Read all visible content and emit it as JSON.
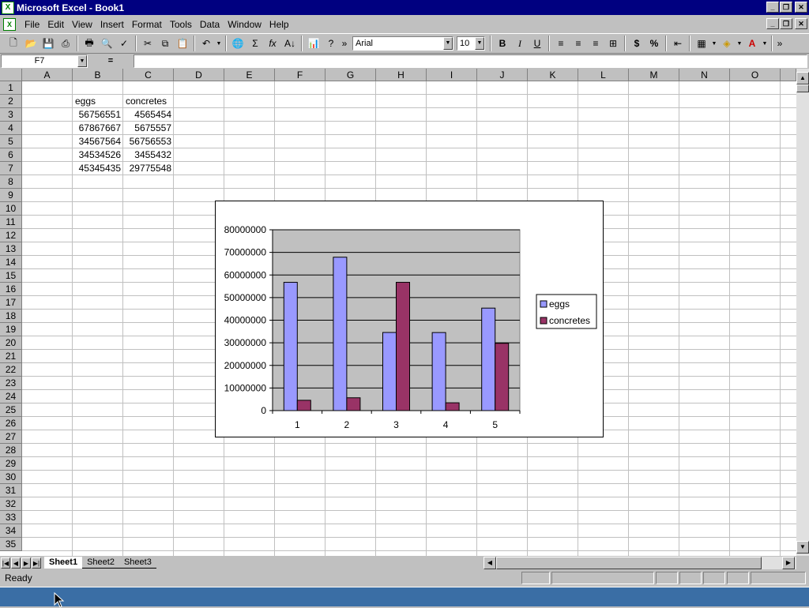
{
  "window": {
    "title": "Microsoft Excel - Book1"
  },
  "menu": [
    "File",
    "Edit",
    "View",
    "Insert",
    "Format",
    "Tools",
    "Data",
    "Window",
    "Help"
  ],
  "toolbar": {
    "font": "Arial",
    "size": "10"
  },
  "formula": {
    "namebox": "F7",
    "eq": "=",
    "value": ""
  },
  "columns": [
    "A",
    "B",
    "C",
    "D",
    "E",
    "F",
    "G",
    "H",
    "I",
    "J",
    "K",
    "L",
    "M",
    "N",
    "O"
  ],
  "rows": [
    "1",
    "2",
    "3",
    "4",
    "5",
    "6",
    "7",
    "8",
    "9",
    "10",
    "11",
    "12",
    "13",
    "14",
    "15",
    "16",
    "17",
    "18",
    "19",
    "20",
    "21",
    "22",
    "23",
    "24",
    "25",
    "26",
    "27",
    "28",
    "29",
    "30",
    "31",
    "32",
    "33",
    "34",
    "35"
  ],
  "cells": {
    "b2": "eggs",
    "c2": "concretes",
    "b3": "56756551",
    "c3": "4565454",
    "b4": "67867667",
    "c4": "5675557",
    "b5": "34567564",
    "c5": "56756553",
    "b6": "34534526",
    "c6": "3455432",
    "b7": "45345435",
    "c7": "29775548"
  },
  "chart_data": {
    "type": "bar",
    "categories": [
      "1",
      "2",
      "3",
      "4",
      "5"
    ],
    "series": [
      {
        "name": "eggs",
        "values": [
          56756551,
          67867667,
          34567564,
          34534526,
          45345435
        ],
        "color": "#9999ff"
      },
      {
        "name": "concretes",
        "values": [
          4565454,
          5675557,
          56756553,
          3455432,
          29775548
        ],
        "color": "#993366"
      }
    ],
    "ylim": [
      0,
      80000000
    ],
    "yticks": [
      "0",
      "10000000",
      "20000000",
      "30000000",
      "40000000",
      "50000000",
      "60000000",
      "70000000",
      "80000000"
    ],
    "plot_bg": "#c0c0c0",
    "grid": true,
    "legend": "right"
  },
  "sheets": [
    "Sheet1",
    "Sheet2",
    "Sheet3"
  ],
  "status": "Ready"
}
